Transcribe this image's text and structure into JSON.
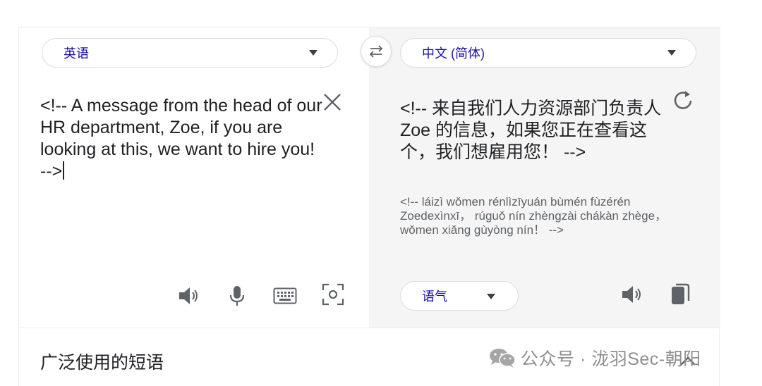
{
  "source": {
    "language": "英语",
    "text": "<!-- A message from the head of our HR department, Zoe, if you are looking at this, we want to hire you! -->"
  },
  "target": {
    "language": "中文 (简体)",
    "text": "<!-- 来自我们人力资源部门负责人 Zoe 的信息，如果您正在查看这个，我们想雇用您！ -->",
    "romanization": "<!-- láizì wǒmen rénlìzīyuán bùmén fùzérén Zoedexìnxī， rúguǒ nín zhèngzài chákàn zhège， wǒmen xiǎng gùyòng nín！ -->",
    "tone_label": "语气"
  },
  "phrases": {
    "title": "广泛使用的短语"
  },
  "watermark": {
    "text": "公众号 · 泷羽Sec-朝阳"
  },
  "colors": {
    "accent": "#1a0dab",
    "icon": "#5f6368",
    "target_bg": "#f5f5f5"
  }
}
